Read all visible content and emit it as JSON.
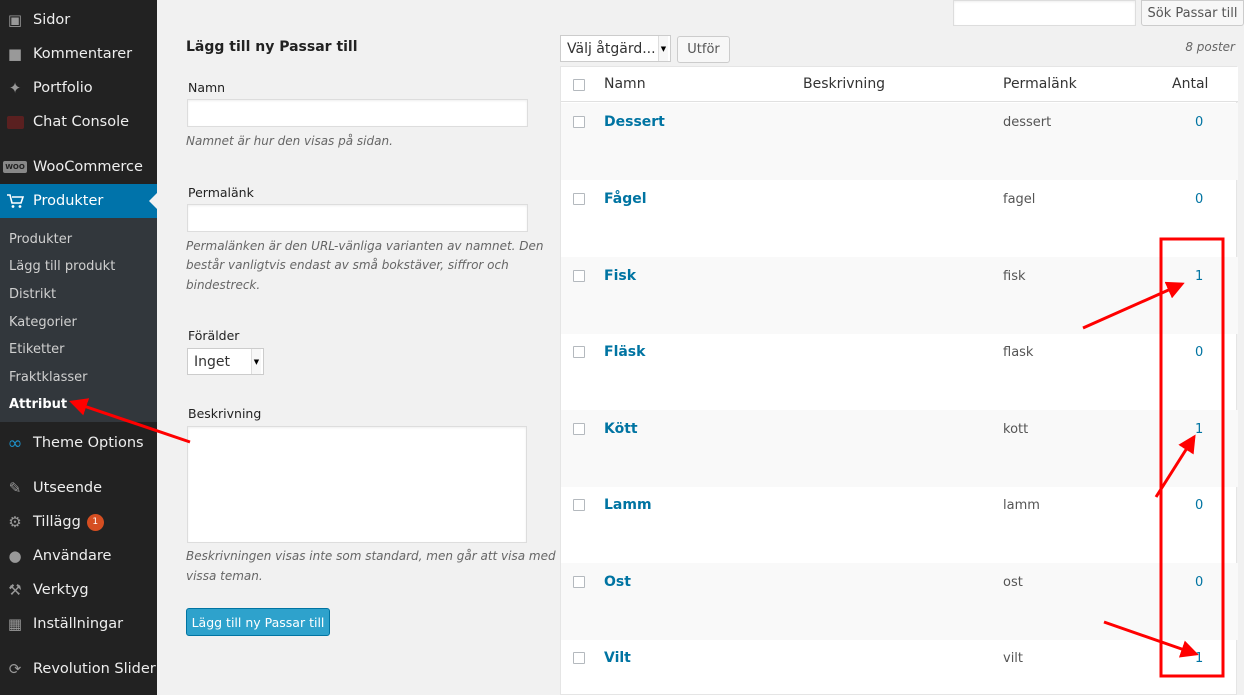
{
  "sidebar": {
    "items": [
      {
        "label": "Sidor",
        "icon": "pages-icon"
      },
      {
        "label": "Kommentarer",
        "icon": "comments-icon"
      },
      {
        "label": "Portfolio",
        "icon": "pin-icon"
      },
      {
        "label": "Chat Console",
        "icon": "chat-console-icon"
      },
      {
        "label": "WooCommerce",
        "icon": "woocommerce-icon",
        "icon_text": "WOO"
      },
      {
        "label": "Produkter",
        "icon": "cart-icon"
      },
      {
        "label": "Theme Options",
        "icon": "infinity-icon"
      },
      {
        "label": "Utseende",
        "icon": "brush-icon"
      },
      {
        "label": "Tillägg",
        "icon": "plugin-icon",
        "badge": "1"
      },
      {
        "label": "Användare",
        "icon": "user-icon"
      },
      {
        "label": "Verktyg",
        "icon": "wrench-icon"
      },
      {
        "label": "Inställningar",
        "icon": "settings-icon"
      },
      {
        "label": "Revolution Slider",
        "icon": "refresh-icon"
      }
    ],
    "submenu": [
      "Produkter",
      "Lägg till produkt",
      "Distrikt",
      "Kategorier",
      "Etiketter",
      "Fraktklasser",
      "Attribut"
    ]
  },
  "search": {
    "button": "Sök Passar till",
    "value": ""
  },
  "form": {
    "title": "Lägg till ny Passar till",
    "name_label": "Namn",
    "name_hint": "Namnet är hur den visas på sidan.",
    "slug_label": "Permalänk",
    "slug_hint_1": "Permalänken är den URL-vänliga varianten av namnet. Den",
    "slug_hint_2": "består vanligtvis endast av små bokstäver, siffror och",
    "slug_hint_3": "bindestreck.",
    "parent_label": "Förälder",
    "parent_value": "Inget",
    "desc_label": "Beskrivning",
    "desc_hint_1": "Beskrivningen visas inte som standard, men går att visa med",
    "desc_hint_2": "vissa teman.",
    "submit": "Lägg till ny Passar till"
  },
  "bulk": {
    "select": "Välj åtgärd...",
    "apply": "Utför",
    "count": "8 poster"
  },
  "table": {
    "headers": {
      "name": "Namn",
      "description": "Beskrivning",
      "slug": "Permalänk",
      "count": "Antal"
    },
    "rows": [
      {
        "name": "Dessert",
        "slug": "dessert",
        "count": "0"
      },
      {
        "name": "Fågel",
        "slug": "fagel",
        "count": "0"
      },
      {
        "name": "Fisk",
        "slug": "fisk",
        "count": "1"
      },
      {
        "name": "Fläsk",
        "slug": "flask",
        "count": "0"
      },
      {
        "name": "Kött",
        "slug": "kott",
        "count": "1"
      },
      {
        "name": "Lamm",
        "slug": "lamm",
        "count": "0"
      },
      {
        "name": "Ost",
        "slug": "ost",
        "count": "0"
      },
      {
        "name": "Vilt",
        "slug": "vilt",
        "count": "1"
      }
    ]
  },
  "colors": {
    "accent": "#0073aa",
    "annotation": "#ff0000",
    "sidebar": "#222222"
  }
}
